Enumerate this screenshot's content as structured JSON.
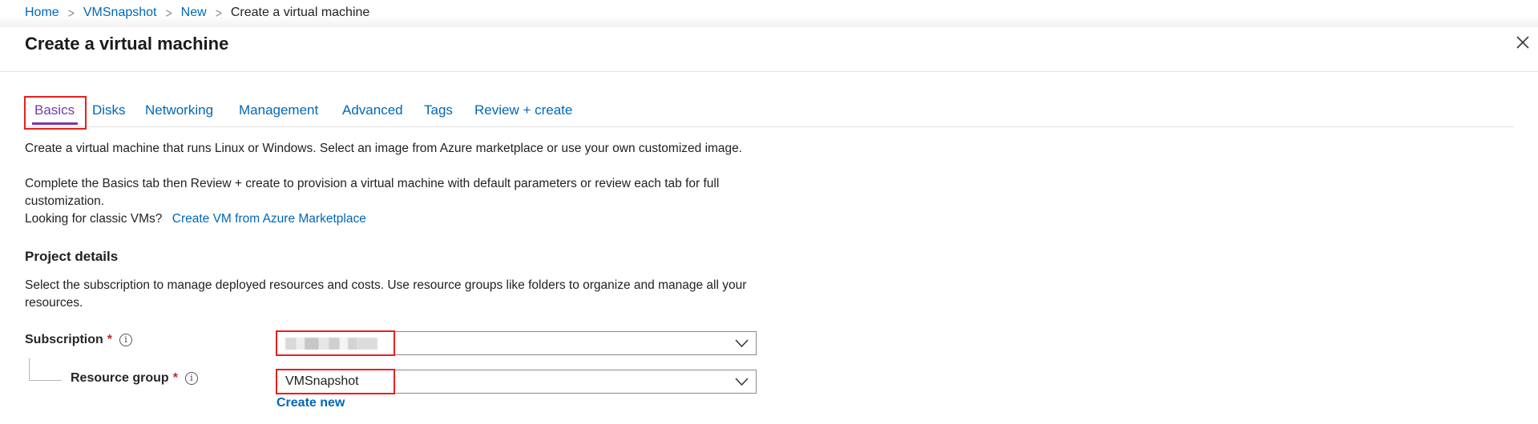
{
  "breadcrumb": {
    "home": "Home",
    "vmsnapshot": "VMSnapshot",
    "new": "New",
    "current": "Create a virtual machine",
    "separator": ">"
  },
  "header": {
    "title": "Create a virtual machine",
    "close_icon": "close-icon"
  },
  "tabs": [
    {
      "label": "Basics",
      "active": true
    },
    {
      "label": "Disks",
      "active": false
    },
    {
      "label": "Networking",
      "active": false
    },
    {
      "label": "Management",
      "active": false
    },
    {
      "label": "Advanced",
      "active": false
    },
    {
      "label": "Tags",
      "active": false
    },
    {
      "label": "Review + create",
      "active": false
    }
  ],
  "intro": {
    "line1": "Create a virtual machine that runs Linux or Windows. Select an image from Azure marketplace or use your own customized image.",
    "line2": "Complete the Basics tab then Review + create to provision a virtual machine with default parameters or review each tab for full customization.",
    "classic_prompt": "Looking for classic VMs?",
    "classic_link": "Create VM from Azure Marketplace"
  },
  "project_details": {
    "heading": "Project details",
    "description": "Select the subscription to manage deployed resources and costs. Use resource groups like folders to organize and manage all your resources."
  },
  "form": {
    "subscription": {
      "label": "Subscription",
      "required_marker": "*",
      "info_glyph": "i",
      "value": ""
    },
    "resource_group": {
      "label": "Resource group",
      "required_marker": "*",
      "info_glyph": "i",
      "value": "VMSnapshot",
      "create_new": "Create new"
    }
  },
  "colors": {
    "link": "#0067b8",
    "active_tab": "#7a38a8",
    "highlight": "#e81f1f",
    "required": "#c4262e"
  }
}
